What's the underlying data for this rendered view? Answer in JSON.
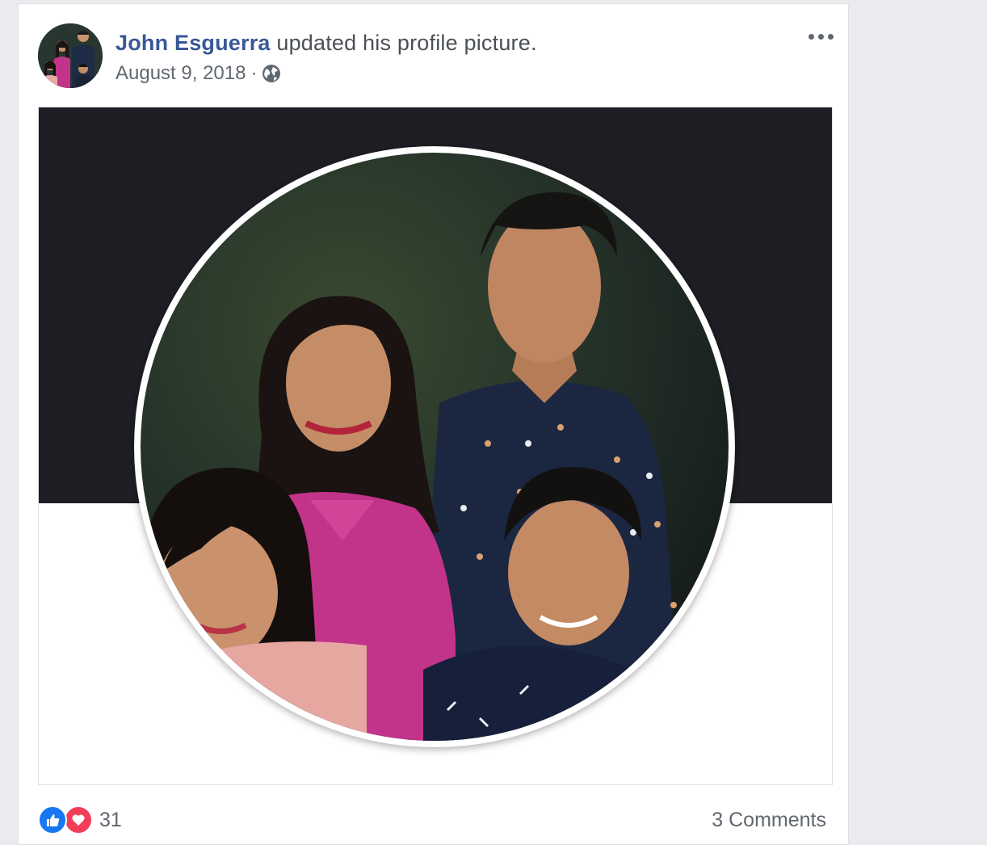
{
  "post": {
    "author": "John Esguerra",
    "action": " updated his profile picture.",
    "date": "August 9, 2018",
    "separator": "·",
    "privacy_icon": "globe-icon",
    "more_icon": "more-options-icon"
  },
  "photo": {
    "cover_color": "#1d1f24",
    "frame_color": "#ffffff"
  },
  "footer": {
    "reaction_icons": [
      "like-icon",
      "love-icon"
    ],
    "reaction_count": "31",
    "comments": "3 Comments"
  },
  "colors": {
    "author_link": "#385898",
    "meta_text": "#616770",
    "like": "#1877f2",
    "love": "#f33e58"
  }
}
